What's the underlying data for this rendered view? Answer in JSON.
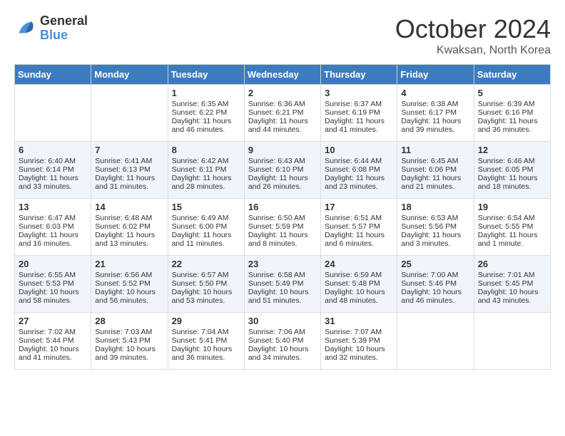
{
  "header": {
    "logo_line1": "General",
    "logo_line2": "Blue",
    "month_title": "October 2024",
    "subtitle": "Kwaksan, North Korea"
  },
  "days_of_week": [
    "Sunday",
    "Monday",
    "Tuesday",
    "Wednesday",
    "Thursday",
    "Friday",
    "Saturday"
  ],
  "weeks": [
    [
      {
        "day": "",
        "sunrise": "",
        "sunset": "",
        "daylight": ""
      },
      {
        "day": "",
        "sunrise": "",
        "sunset": "",
        "daylight": ""
      },
      {
        "day": "1",
        "sunrise": "Sunrise: 6:35 AM",
        "sunset": "Sunset: 6:22 PM",
        "daylight": "Daylight: 11 hours and 46 minutes."
      },
      {
        "day": "2",
        "sunrise": "Sunrise: 6:36 AM",
        "sunset": "Sunset: 6:21 PM",
        "daylight": "Daylight: 11 hours and 44 minutes."
      },
      {
        "day": "3",
        "sunrise": "Sunrise: 6:37 AM",
        "sunset": "Sunset: 6:19 PM",
        "daylight": "Daylight: 11 hours and 41 minutes."
      },
      {
        "day": "4",
        "sunrise": "Sunrise: 6:38 AM",
        "sunset": "Sunset: 6:17 PM",
        "daylight": "Daylight: 11 hours and 39 minutes."
      },
      {
        "day": "5",
        "sunrise": "Sunrise: 6:39 AM",
        "sunset": "Sunset: 6:16 PM",
        "daylight": "Daylight: 11 hours and 36 minutes."
      }
    ],
    [
      {
        "day": "6",
        "sunrise": "Sunrise: 6:40 AM",
        "sunset": "Sunset: 6:14 PM",
        "daylight": "Daylight: 11 hours and 33 minutes."
      },
      {
        "day": "7",
        "sunrise": "Sunrise: 6:41 AM",
        "sunset": "Sunset: 6:13 PM",
        "daylight": "Daylight: 11 hours and 31 minutes."
      },
      {
        "day": "8",
        "sunrise": "Sunrise: 6:42 AM",
        "sunset": "Sunset: 6:11 PM",
        "daylight": "Daylight: 11 hours and 28 minutes."
      },
      {
        "day": "9",
        "sunrise": "Sunrise: 6:43 AM",
        "sunset": "Sunset: 6:10 PM",
        "daylight": "Daylight: 11 hours and 26 minutes."
      },
      {
        "day": "10",
        "sunrise": "Sunrise: 6:44 AM",
        "sunset": "Sunset: 6:08 PM",
        "daylight": "Daylight: 11 hours and 23 minutes."
      },
      {
        "day": "11",
        "sunrise": "Sunrise: 6:45 AM",
        "sunset": "Sunset: 6:06 PM",
        "daylight": "Daylight: 11 hours and 21 minutes."
      },
      {
        "day": "12",
        "sunrise": "Sunrise: 6:46 AM",
        "sunset": "Sunset: 6:05 PM",
        "daylight": "Daylight: 11 hours and 18 minutes."
      }
    ],
    [
      {
        "day": "13",
        "sunrise": "Sunrise: 6:47 AM",
        "sunset": "Sunset: 6:03 PM",
        "daylight": "Daylight: 11 hours and 16 minutes."
      },
      {
        "day": "14",
        "sunrise": "Sunrise: 6:48 AM",
        "sunset": "Sunset: 6:02 PM",
        "daylight": "Daylight: 11 hours and 13 minutes."
      },
      {
        "day": "15",
        "sunrise": "Sunrise: 6:49 AM",
        "sunset": "Sunset: 6:00 PM",
        "daylight": "Daylight: 11 hours and 11 minutes."
      },
      {
        "day": "16",
        "sunrise": "Sunrise: 6:50 AM",
        "sunset": "Sunset: 5:59 PM",
        "daylight": "Daylight: 11 hours and 8 minutes."
      },
      {
        "day": "17",
        "sunrise": "Sunrise: 6:51 AM",
        "sunset": "Sunset: 5:57 PM",
        "daylight": "Daylight: 11 hours and 6 minutes."
      },
      {
        "day": "18",
        "sunrise": "Sunrise: 6:53 AM",
        "sunset": "Sunset: 5:56 PM",
        "daylight": "Daylight: 11 hours and 3 minutes."
      },
      {
        "day": "19",
        "sunrise": "Sunrise: 6:54 AM",
        "sunset": "Sunset: 5:55 PM",
        "daylight": "Daylight: 11 hours and 1 minute."
      }
    ],
    [
      {
        "day": "20",
        "sunrise": "Sunrise: 6:55 AM",
        "sunset": "Sunset: 5:53 PM",
        "daylight": "Daylight: 10 hours and 58 minutes."
      },
      {
        "day": "21",
        "sunrise": "Sunrise: 6:56 AM",
        "sunset": "Sunset: 5:52 PM",
        "daylight": "Daylight: 10 hours and 56 minutes."
      },
      {
        "day": "22",
        "sunrise": "Sunrise: 6:57 AM",
        "sunset": "Sunset: 5:50 PM",
        "daylight": "Daylight: 10 hours and 53 minutes."
      },
      {
        "day": "23",
        "sunrise": "Sunrise: 6:58 AM",
        "sunset": "Sunset: 5:49 PM",
        "daylight": "Daylight: 10 hours and 51 minutes."
      },
      {
        "day": "24",
        "sunrise": "Sunrise: 6:59 AM",
        "sunset": "Sunset: 5:48 PM",
        "daylight": "Daylight: 10 hours and 48 minutes."
      },
      {
        "day": "25",
        "sunrise": "Sunrise: 7:00 AM",
        "sunset": "Sunset: 5:46 PM",
        "daylight": "Daylight: 10 hours and 46 minutes."
      },
      {
        "day": "26",
        "sunrise": "Sunrise: 7:01 AM",
        "sunset": "Sunset: 5:45 PM",
        "daylight": "Daylight: 10 hours and 43 minutes."
      }
    ],
    [
      {
        "day": "27",
        "sunrise": "Sunrise: 7:02 AM",
        "sunset": "Sunset: 5:44 PM",
        "daylight": "Daylight: 10 hours and 41 minutes."
      },
      {
        "day": "28",
        "sunrise": "Sunrise: 7:03 AM",
        "sunset": "Sunset: 5:43 PM",
        "daylight": "Daylight: 10 hours and 39 minutes."
      },
      {
        "day": "29",
        "sunrise": "Sunrise: 7:04 AM",
        "sunset": "Sunset: 5:41 PM",
        "daylight": "Daylight: 10 hours and 36 minutes."
      },
      {
        "day": "30",
        "sunrise": "Sunrise: 7:06 AM",
        "sunset": "Sunset: 5:40 PM",
        "daylight": "Daylight: 10 hours and 34 minutes."
      },
      {
        "day": "31",
        "sunrise": "Sunrise: 7:07 AM",
        "sunset": "Sunset: 5:39 PM",
        "daylight": "Daylight: 10 hours and 32 minutes."
      },
      {
        "day": "",
        "sunrise": "",
        "sunset": "",
        "daylight": ""
      },
      {
        "day": "",
        "sunrise": "",
        "sunset": "",
        "daylight": ""
      }
    ]
  ]
}
